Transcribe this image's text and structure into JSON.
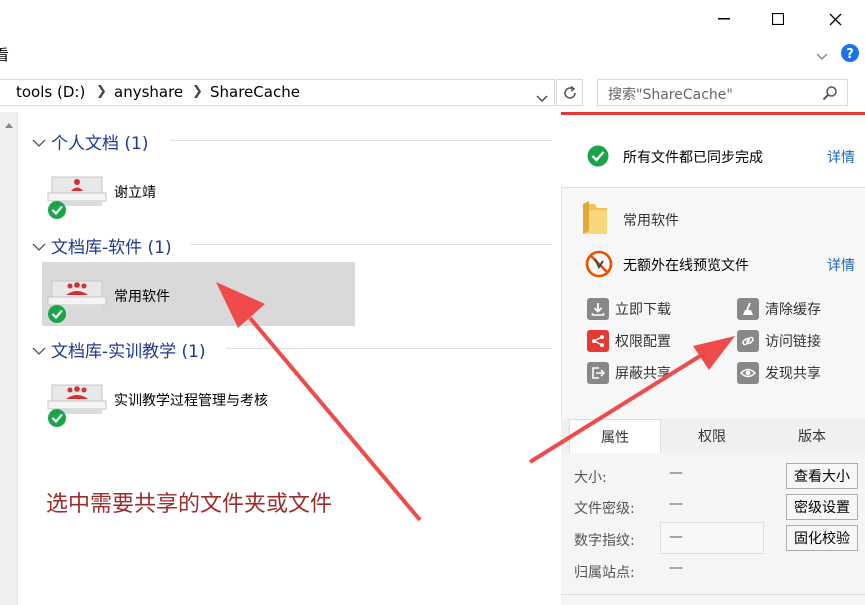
{
  "ribbon": {
    "partial_label": "看"
  },
  "address": {
    "crumbs": [
      "tools (D:)",
      "anyshare",
      "ShareCache"
    ],
    "search_placeholder": "搜索\"ShareCache\""
  },
  "groups": [
    {
      "header": "个人文档 (1)",
      "items": [
        {
          "label": "谢立靖"
        }
      ]
    },
    {
      "header": "文档库-软件 (1)",
      "items": [
        {
          "label": "常用软件"
        }
      ]
    },
    {
      "header": "文档库-实训教学 (1)",
      "items": [
        {
          "label": "实训教学过程管理与考核"
        }
      ]
    }
  ],
  "annotation": {
    "text": "选中需要共享的文件夹或文件"
  },
  "panel": {
    "sync_status": "所有文件都已同步完成",
    "sync_details": "详情",
    "folder_name": "常用软件",
    "preview_status": "无额外在线预览文件",
    "preview_details": "详情",
    "actions": {
      "download": "立即下载",
      "clear_cache": "清除缓存",
      "permissions": "权限配置",
      "access_link": "访问链接",
      "block_share": "屏蔽共享",
      "discover_share": "发现共享"
    },
    "tabs": [
      "属性",
      "权限",
      "版本"
    ],
    "props": {
      "size_label": "大小:",
      "size_value": "—",
      "size_button": "查看大小",
      "secret_label": "文件密级:",
      "secret_value": "—",
      "secret_button": "密级设置",
      "fingerprint_label": "数字指纹:",
      "fingerprint_value": "—",
      "fingerprint_button": "固化校验",
      "site_label": "归属站点:",
      "site_value": "—"
    }
  },
  "colors": {
    "accent_red": "#e53935",
    "link_blue": "#1565c0",
    "group_blue": "#1e3a8a",
    "annotation": "#9b2d2d",
    "check_green": "#1aa54a"
  }
}
